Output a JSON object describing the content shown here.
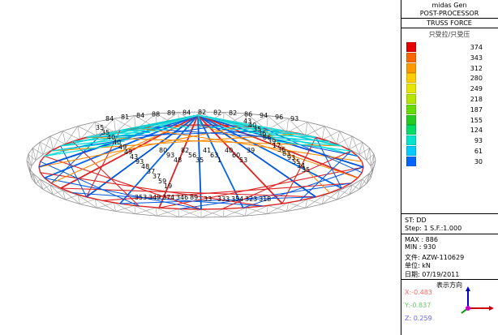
{
  "header": {
    "app": "midas Gen",
    "mode": "POST-PROCESSOR",
    "result": "TRUSS FORCE",
    "subtitle": "只受拉/只受压"
  },
  "legend": [
    {
      "value": "374",
      "color": "#e60000"
    },
    {
      "value": "343",
      "color": "#ff6600"
    },
    {
      "value": "312",
      "color": "#ff9900"
    },
    {
      "value": "280",
      "color": "#ffcc00"
    },
    {
      "value": "249",
      "color": "#e6e600"
    },
    {
      "value": "218",
      "color": "#b3e600"
    },
    {
      "value": "187",
      "color": "#66dd00"
    },
    {
      "value": "155",
      "color": "#22cc22"
    },
    {
      "value": "124",
      "color": "#00dd66"
    },
    {
      "value": "93",
      "color": "#00e6cc"
    },
    {
      "value": "61",
      "color": "#00ccff"
    },
    {
      "value": "30",
      "color": "#0066ff"
    }
  ],
  "info": {
    "st": "ST: DD",
    "step": "Step: 1 S.F.:1.000",
    "max": "MAX : 886",
    "min": "MIN : 930",
    "file": "文件: AZW-110629",
    "unit": "单位: kN",
    "date": "日期: 07/19/2011"
  },
  "view": {
    "title": "表示方向",
    "x": "X:-0.483",
    "y": "Y:-0.837",
    "z": "Z: 0.259",
    "x_color": "#ff6666",
    "y_color": "#66cc66",
    "z_color": "#6666ff"
  },
  "labels": {
    "top": [
      "84",
      "81",
      "84",
      "88",
      "89",
      "84",
      "82",
      "82",
      "82",
      "86",
      "94",
      "96",
      "93"
    ],
    "left": [
      "35",
      "35",
      "40",
      "40",
      "49",
      "49",
      "43",
      "93",
      "48",
      "37",
      "37",
      "59",
      "19"
    ],
    "center": [
      "80",
      "93",
      "48",
      "82",
      "56",
      "35",
      "41",
      "63",
      "1",
      "40",
      "60",
      "53",
      "39"
    ],
    "right": [
      "43",
      "40",
      "35",
      "36",
      "86",
      "39",
      "17",
      "36",
      "83",
      "93",
      "55",
      "34",
      "35"
    ],
    "bottom": [
      "353",
      "349",
      "374",
      "346",
      "89",
      "33",
      "333",
      "354",
      "323",
      "318"
    ]
  }
}
